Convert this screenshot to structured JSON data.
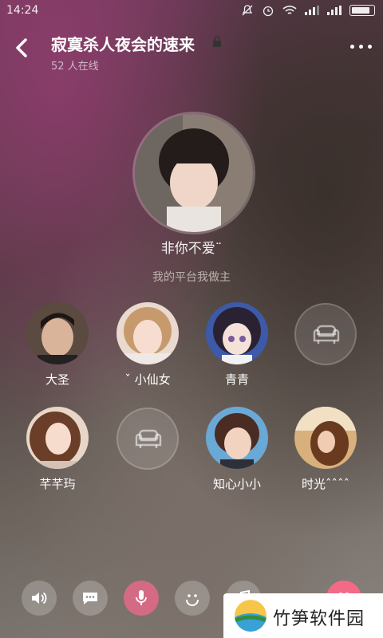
{
  "status_bar": {
    "time": "14:24",
    "icons": [
      "mute-icon",
      "alarm-icon",
      "wifi-icon",
      "signal-icon",
      "signal-icon",
      "battery-icon"
    ]
  },
  "header": {
    "title": "寂寞杀人夜会的速来",
    "online": "52 人在线"
  },
  "host": {
    "name": "非你不爱¨",
    "subtitle": "我的平台我做主"
  },
  "seats": [
    {
      "label": "大圣",
      "occupied": true
    },
    {
      "label": "ˇ 小仙女",
      "occupied": true
    },
    {
      "label": "青青",
      "occupied": true
    },
    {
      "label": "",
      "occupied": false
    },
    {
      "label": "芊芊玙",
      "occupied": true
    },
    {
      "label": "",
      "occupied": false
    },
    {
      "label": "知心小小",
      "occupied": true
    },
    {
      "label": "时光ˆˆˆˆ",
      "occupied": true
    }
  ],
  "toolbar": {
    "items": [
      "speaker-icon",
      "chat-icon",
      "microphone-icon",
      "emoji-icon",
      "music-icon",
      "gift-icon"
    ]
  },
  "watermark": {
    "text": "竹笋软件园"
  },
  "colors": {
    "mic": "#d46a83",
    "gift": "#f26a88",
    "accent_purple": "#8a3d6a"
  }
}
